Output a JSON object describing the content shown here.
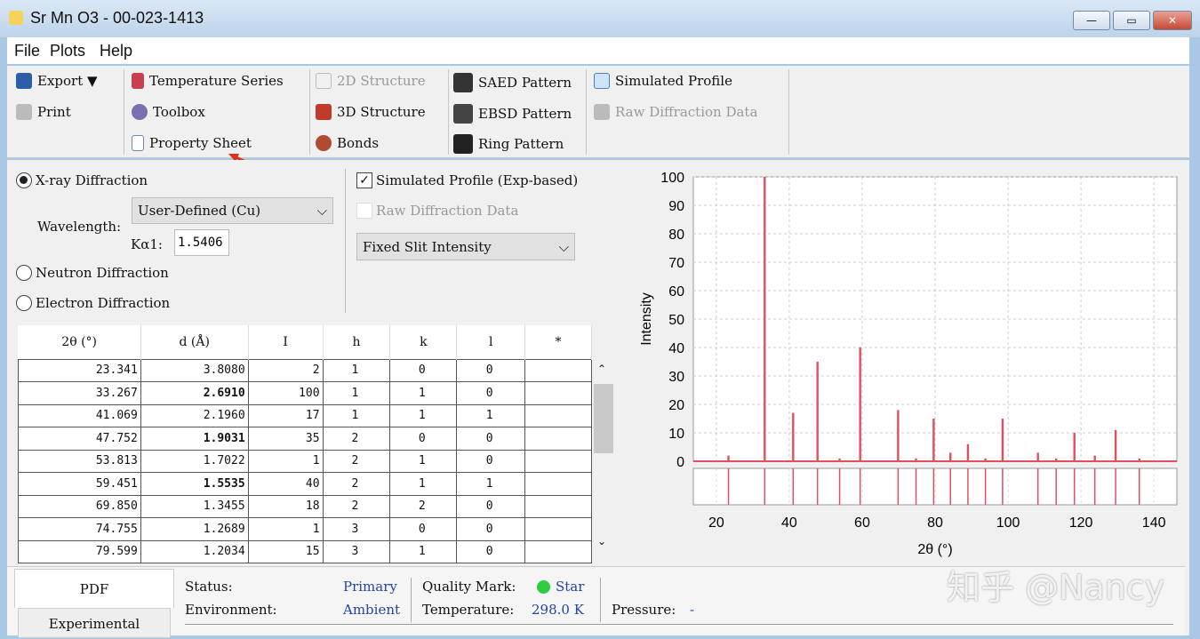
{
  "window": {
    "title": "Sr Mn O3 - 00-023-1413",
    "min": "—",
    "max": "▭",
    "close": "✕"
  },
  "menu": [
    "File",
    "Plots",
    "Help"
  ],
  "toolbar": {
    "export": "Export ▼",
    "print": "Print",
    "temperature_series": "Temperature Series",
    "toolbox": "Toolbox",
    "property_sheet": "Property Sheet",
    "structure_2d": "2D Structure",
    "structure_3d": "3D Structure",
    "bonds": "Bonds",
    "saed": "SAED Pattern",
    "ebsd": "EBSD Pattern",
    "ring": "Ring Pattern",
    "simulated_profile": "Simulated Profile",
    "raw_diffraction": "Raw Diffraction Data"
  },
  "options": {
    "xray": "X-ray Diffraction",
    "wavelength_label": "Wavelength:",
    "wavelength_select": "User-Defined (Cu)",
    "ka1_label": "Kα1:",
    "ka1_value": "1.5406",
    "neutron": "Neutron Diffraction",
    "electron": "Electron Diffraction",
    "sim_profile": "Simulated Profile (Exp-based)",
    "raw_data": "Raw Diffraction Data",
    "intensity_mode": "Fixed Slit Intensity"
  },
  "table": {
    "headers": [
      "2θ (°)",
      "d (Å)",
      "I",
      "h",
      "k",
      "l",
      "*"
    ],
    "rows": [
      [
        "23.341",
        "3.8080",
        "2",
        "1",
        "0",
        "0",
        ""
      ],
      [
        "33.267",
        "2.6910",
        "100",
        "1",
        "1",
        "0",
        ""
      ],
      [
        "41.069",
        "2.1960",
        "17",
        "1",
        "1",
        "1",
        ""
      ],
      [
        "47.752",
        "1.9031",
        "35",
        "2",
        "0",
        "0",
        ""
      ],
      [
        "53.813",
        "1.7022",
        "1",
        "2",
        "1",
        "0",
        ""
      ],
      [
        "59.451",
        "1.5535",
        "40",
        "2",
        "1",
        "1",
        ""
      ],
      [
        "69.850",
        "1.3455",
        "18",
        "2",
        "2",
        "0",
        ""
      ],
      [
        "74.755",
        "1.2689",
        "1",
        "3",
        "0",
        "0",
        ""
      ],
      [
        "79.599",
        "1.2034",
        "15",
        "3",
        "1",
        "0",
        ""
      ]
    ],
    "bold_rows": [
      1,
      3,
      5
    ]
  },
  "bottom": {
    "tab_pdf": "PDF",
    "tab_experimental": "Experimental",
    "status_label": "Status:",
    "status_value": "Primary",
    "quality_label": "Quality Mark:",
    "quality_value": "Star",
    "env_label": "Environment:",
    "env_value": "Ambient",
    "temp_label": "Temperature:",
    "temp_value": "298.0 K",
    "pressure_label": "Pressure:",
    "pressure_value": "-"
  },
  "watermark": "知乎 @Nancy",
  "colors": {
    "peak": "#e0505f",
    "quality_dot": "#2ecc40",
    "accent_blue": "#2244aa"
  },
  "chart_data": {
    "type": "bar",
    "xlabel": "2θ (°)",
    "ylabel": "Intensity",
    "xlim": [
      13.7,
      146.3
    ],
    "ylim": [
      0,
      100
    ],
    "xticks": [
      20,
      40,
      60,
      80,
      100,
      120,
      140
    ],
    "yticks": [
      0,
      10,
      20,
      30,
      40,
      50,
      60,
      70,
      80,
      90,
      100
    ],
    "grid": true,
    "x": [
      23.34,
      33.27,
      41.07,
      47.75,
      53.81,
      59.45,
      69.85,
      74.76,
      79.6,
      84.2,
      89.0,
      93.8,
      98.5,
      108.2,
      113.2,
      118.2,
      123.8,
      129.5,
      136.0
    ],
    "values": [
      2,
      100,
      17,
      35,
      1,
      40,
      18,
      1,
      15,
      3,
      6,
      1,
      15,
      3,
      1,
      10,
      2,
      11,
      1
    ]
  }
}
